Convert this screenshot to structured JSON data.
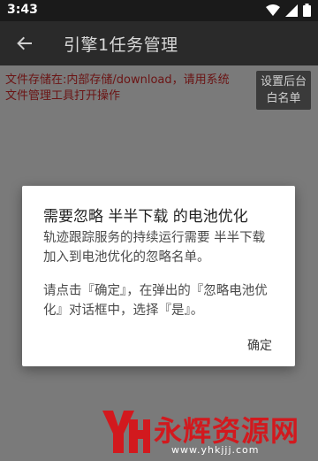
{
  "status_bar": {
    "time": "3:43"
  },
  "app_bar": {
    "title": "引擎1任务管理"
  },
  "content": {
    "notice_text": "文件存储在:内部存储/download，请用系统文件管理工具打开操作",
    "whitelist_button_label": "设置后台白名单"
  },
  "dialog": {
    "title": "需要忽略 半半下载 的电池优化",
    "message_1": "轨迹跟踪服务的持续运行需要 半半下载 加入到电池优化的忽略名单。",
    "message_2": "请点击『确定』，在弹出的『忽略电池优化』对话框中，选择『是』。",
    "ok_label": "确定"
  },
  "watermark": {
    "text": "永辉资源网",
    "url": "www.yhkjjj.com"
  },
  "colors": {
    "notice_red": "#6b1414",
    "watermark_red": "#d2191e"
  }
}
